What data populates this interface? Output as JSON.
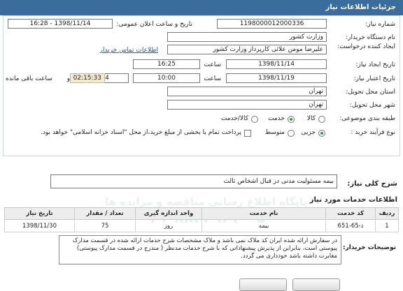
{
  "header": {
    "title": "جزئیات اطلاعات نیاز"
  },
  "form": {
    "need_number_label": "شماره نیاز:",
    "need_number": "1198000012000336",
    "announce_label": "تاریخ و ساعت اعلان عمومی:",
    "announce_value": "1398/11/14 - 16:28",
    "buyer_org_label": "نام دستگاه خریدار:",
    "buyer_org": "وزارت کشور",
    "requester_label": "ایجاد کننده درخواست:",
    "requester": "علیرضا مومن علائی کارپرداز وزارت کشور",
    "contact_link": "اطلاعات تماس خریدار",
    "created_label": "تاریخ ایجاد نیاز:",
    "created_date": "1398/11/14",
    "time_label": "ساعت",
    "created_time": "16:25",
    "deadline_label": "تاریخ اعتبار نیاز:",
    "deadline_date": "1398/11/19",
    "deadline_time": "10:00",
    "days": "4",
    "day_and_label": "روز و",
    "remaining_time": "02:15:33",
    "remaining_label": "ساعت باقی مانده",
    "province_label": "استان محل تحویل:",
    "province": "تهران",
    "city_label": "شهر محل تحویل:",
    "city": "تهران",
    "category_label": "طبقه بندی موضوعی:",
    "category_options": [
      "کالا",
      "خدمت",
      "کالا/خدمت"
    ],
    "purchase_type_label": "نوع فرآیند خرید :",
    "purchase_type_options": [
      "جزیی",
      "متوسط"
    ],
    "payment_note": "پرداخت تمام یا بخشی از مبلغ خرید،از محل \"اسناد خزانه اسلامی\" خواهد بود."
  },
  "summary": {
    "label": "شرح کلی نیاز:",
    "value": "بیمه مسئولیت مدنی در قبال اشخاص ثالث"
  },
  "services_title": "اطلاعات خدمات مورد نیاز",
  "table": {
    "headers": [
      "ردیف",
      "کد خدمت",
      "نام خدمت",
      "واحد اندازه گیری",
      "تعداد / مقدار",
      "تاریخ نیاز"
    ],
    "rows": [
      [
        "1",
        "ذ-65-651",
        "بیمه",
        "روز",
        "75",
        "1398/11/30"
      ]
    ]
  },
  "buyer_notes_label": "توضیحات خریدار:",
  "buyer_notes": "در سفارش ارائه شده ایران کد ملاک نمی باشد و ملاک مشخصات شرح خدمات ارائه شده در قسمت مدارک پیوستی است، بنابراین از پذیرش پیشنهاداتی که با شرح خدمات مدنظر ( مندرج در قسمت مدارک پیوستی) مغایرت داشته باشد خودداری می گردد.",
  "watermarks": [
    "پارس ناد داده",
    "پایگاه اطلاع رسانی مناقصه و مزایده ها",
    "۰۲۱-۸۸۳۴۹۶۷۰-۵",
    "ParsNamadData"
  ]
}
